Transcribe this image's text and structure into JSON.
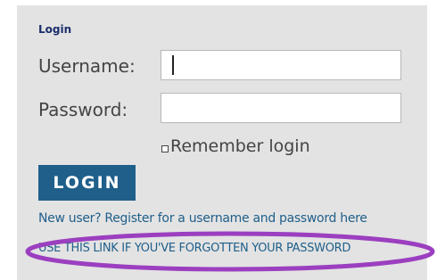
{
  "login_form": {
    "heading": "Login",
    "username_label": "Username:",
    "username_value": "",
    "password_label": "Password:",
    "password_value": "",
    "remember_checked": false,
    "remember_label": "Remember login",
    "login_button": "LOGIN",
    "register_link": "New user? Register for a username and password here",
    "forgot_link": "USE THIS LINK IF YOU'VE FORGOTTEN YOUR PASSWORD"
  },
  "annotation": {
    "highlight_color": "#9b3fc0"
  },
  "colors": {
    "panel_background": "#e3e3e3",
    "heading": "#1b2e6b",
    "button_background": "#1f5f8a",
    "link": "#1f5f8a"
  }
}
